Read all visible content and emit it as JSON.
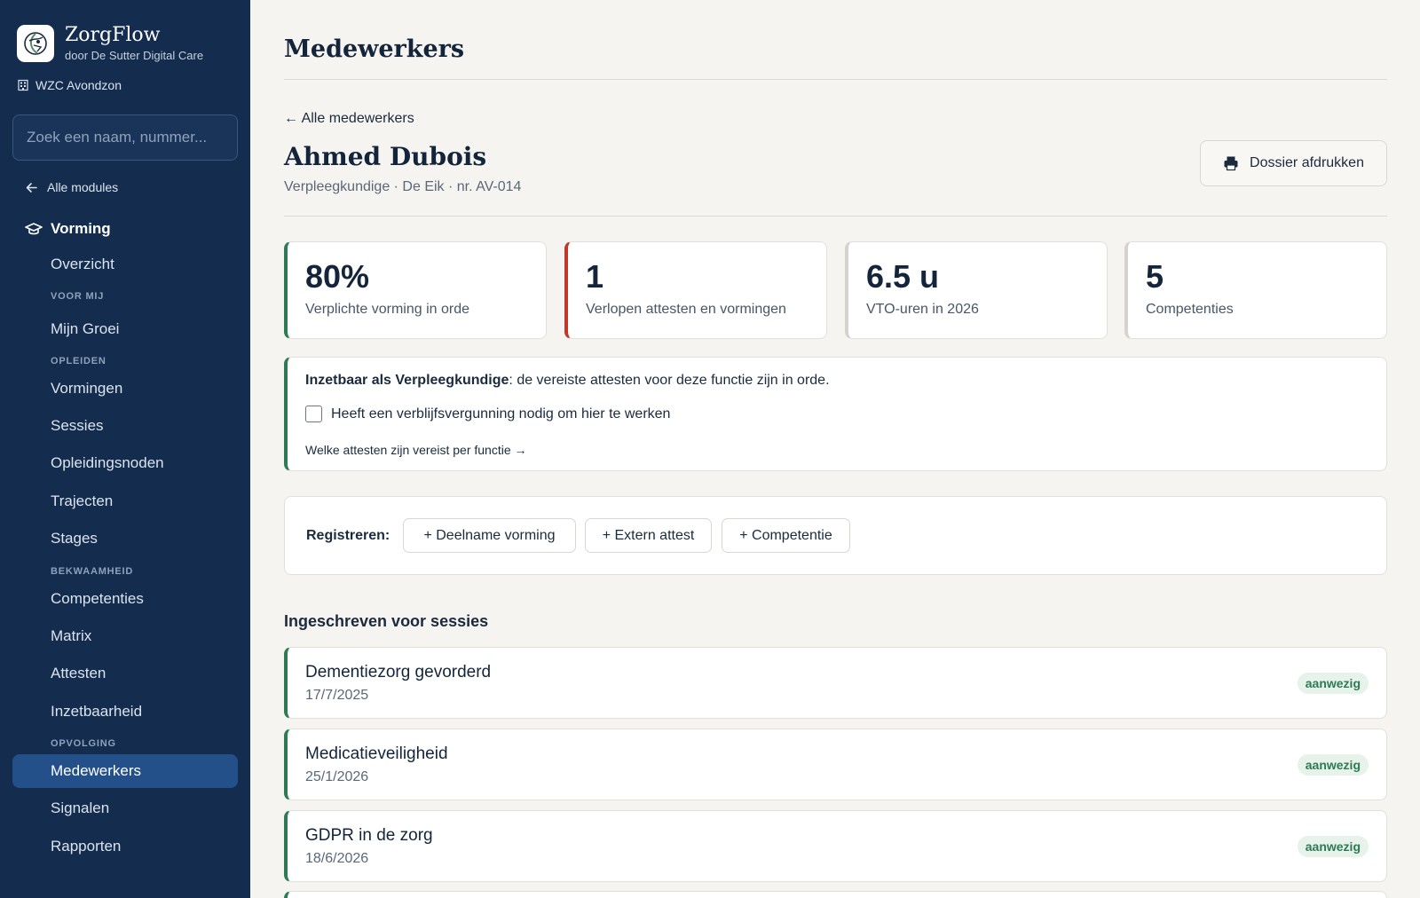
{
  "app": {
    "name": "ZorgFlow",
    "subtitle": "door De Sutter Digital Care",
    "facility": "WZC Avondzon"
  },
  "sidebar": {
    "search_placeholder": "Zoek een naam, nummer...",
    "back_label": "Alle modules",
    "module_label": "Vorming",
    "items": {
      "overzicht": "Overzicht",
      "section_voor_mij": "VOOR MIJ",
      "mijn_groei": "Mijn Groei",
      "section_opleiden": "OPLEIDEN",
      "vormingen": "Vormingen",
      "sessies": "Sessies",
      "opleidingsnoden": "Opleidingsnoden",
      "trajecten": "Trajecten",
      "stages": "Stages",
      "section_bekwaamheid": "BEKWAAMHEID",
      "competenties": "Competenties",
      "matrix": "Matrix",
      "attesten": "Attesten",
      "inzetbaarheid": "Inzetbaarheid",
      "section_opvolging": "OPVOLGING",
      "medewerkers": "Medewerkers",
      "signalen": "Signalen",
      "rapporten": "Rapporten"
    },
    "active_item": "Medewerkers"
  },
  "page": {
    "title": "Medewerkers",
    "back_link": "← Alle medewerkers",
    "person_name": "Ahmed Dubois",
    "person_meta": "Verpleegkundige · De Eik · nr. AV-014",
    "print_label": "Dossier afdrukken"
  },
  "stats": [
    {
      "value": "80%",
      "label": "Verplichte vorming in orde",
      "accent": "#2d7a55"
    },
    {
      "value": "1",
      "label": "Verlopen attesten en vormingen",
      "accent": "#c0392b"
    },
    {
      "value": "6.5 u",
      "label": "VTO-uren in 2026",
      "accent": "#d5d3cd"
    },
    {
      "value": "5",
      "label": "Competenties",
      "accent": "#d5d3cd"
    }
  ],
  "deployability": {
    "strong": "Inzetbaar als Verpleegkundige",
    "rest": ": de vereiste attesten voor deze functie zijn in orde.",
    "checkbox_label": "Heeft een verblijfsvergunning nodig om hier te werken",
    "checkbox_checked": false,
    "link": "Welke attesten zijn vereist per functie →"
  },
  "register": {
    "label": "Registreren:",
    "buttons": [
      "+ Deelname vorming",
      "+ Extern attest",
      "+ Competentie"
    ]
  },
  "sessions": {
    "title": "Ingeschreven voor sessies",
    "items": [
      {
        "title": "Dementiezorg gevorderd",
        "date": "17/7/2025",
        "status": "aanwezig"
      },
      {
        "title": "Medicatieveiligheid",
        "date": "25/1/2026",
        "status": "aanwezig"
      },
      {
        "title": "GDPR in de zorg",
        "date": "18/6/2026",
        "status": "aanwezig"
      }
    ]
  },
  "colors": {
    "sidebar_bg": "#142c4e",
    "active_bg": "#24508a",
    "ok_green": "#2d7a55",
    "alert_red": "#c0392b"
  }
}
